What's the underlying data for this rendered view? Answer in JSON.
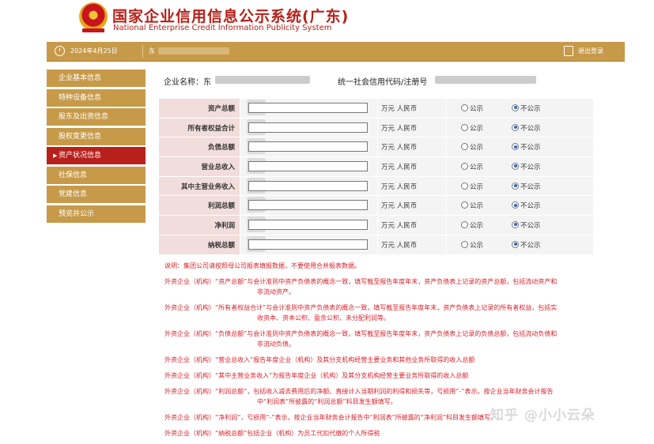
{
  "header": {
    "title_cn": "国家企业信用信息公示系统(广东)",
    "title_en": "National Enterprise Credit Information Publicity System"
  },
  "topbar": {
    "date": "2024年4月25日",
    "org_prefix": "东",
    "logout_label": "退出登录"
  },
  "sidebar": {
    "items": [
      {
        "label": "企业基本信息"
      },
      {
        "label": "特种设备信息"
      },
      {
        "label": "股东及出资信息"
      },
      {
        "label": "股权变更信息"
      },
      {
        "label": "资产状况信息",
        "active": true
      },
      {
        "label": "社保信息"
      },
      {
        "label": "党建信息"
      },
      {
        "label": "预览并公示"
      }
    ]
  },
  "company": {
    "name_label": "企业名称：东",
    "code_label": "统一社会信用代码/注册号"
  },
  "form": {
    "unit_label": "万元 人民币",
    "public_label": "公示",
    "nonpublic_label": "不公示",
    "rows": [
      {
        "label": "资产总额",
        "value": "",
        "public": false
      },
      {
        "label": "所有者权益合计",
        "value": "",
        "public": false
      },
      {
        "label": "负债总额",
        "value": "",
        "public": false
      },
      {
        "label": "营业总收入",
        "value": "",
        "public": false
      },
      {
        "label": "其中主营业务收入",
        "value": "",
        "public": false
      },
      {
        "label": "利润总额",
        "value": "",
        "public": false
      },
      {
        "label": "净利润",
        "value": "",
        "public": false
      },
      {
        "label": "纳税总额",
        "value": "",
        "public": false
      }
    ]
  },
  "notes": {
    "n0": "说明：集团公司请按照母公司报表填报数据，不要使用合并报表数据。",
    "n1a": "外资企业（机构）“资产总额”与会计准则中资产负债表的概念一致，填写截至报告年度年末，资产负债表上记录的资产总额，包括流动资产和",
    "n1b": "非流动资产。",
    "n2a": "外资企业（机构）“所有者权益合计”与会计准则中资产负债表的概念一致，填写截至报告年度年末，资产负债表上记录的所有者权益，包括实",
    "n2b": "收资本、资本公积、盈余公积、未分配利润等。",
    "n3a": "外资企业（机构）“负债总额”与会计准则中资产负债表的概念一致，填写截至报告年度年末，资产负债表上记录的负债总额，包括流动负债和",
    "n3b": "非流动负债。",
    "n4": "外资企业（机构）“营业总收入”报告年度企业（机构）及其分支机构经营主要业务和其他业务所取得的收入总额",
    "n5": "外资企业（机构）“其中主营业务收入”为报告年度企业（机构）及其分支机构经营主要业务所取得的收入总额",
    "n6a": "外资企业（机构）“利润总额”，包括收入减去费用后的净额、直接计入当期利润的利得和损失等，亏损用“-”表示。按企业当年财务会计报告",
    "n6b": "中“利润表”所披露的“利润总额”科目发生额填写。",
    "n7": "外资企业（机构）“净利润”，亏损用“-”表示，按企业当年财务会计报告中“利润表”所披露的“净利润”科目发生额填写。",
    "n8": "外资企业（机构）“纳税总额”包括企业（机构）为员工代扣代缴的个人所得税"
  },
  "watermark": "知乎 @小小云朵"
}
